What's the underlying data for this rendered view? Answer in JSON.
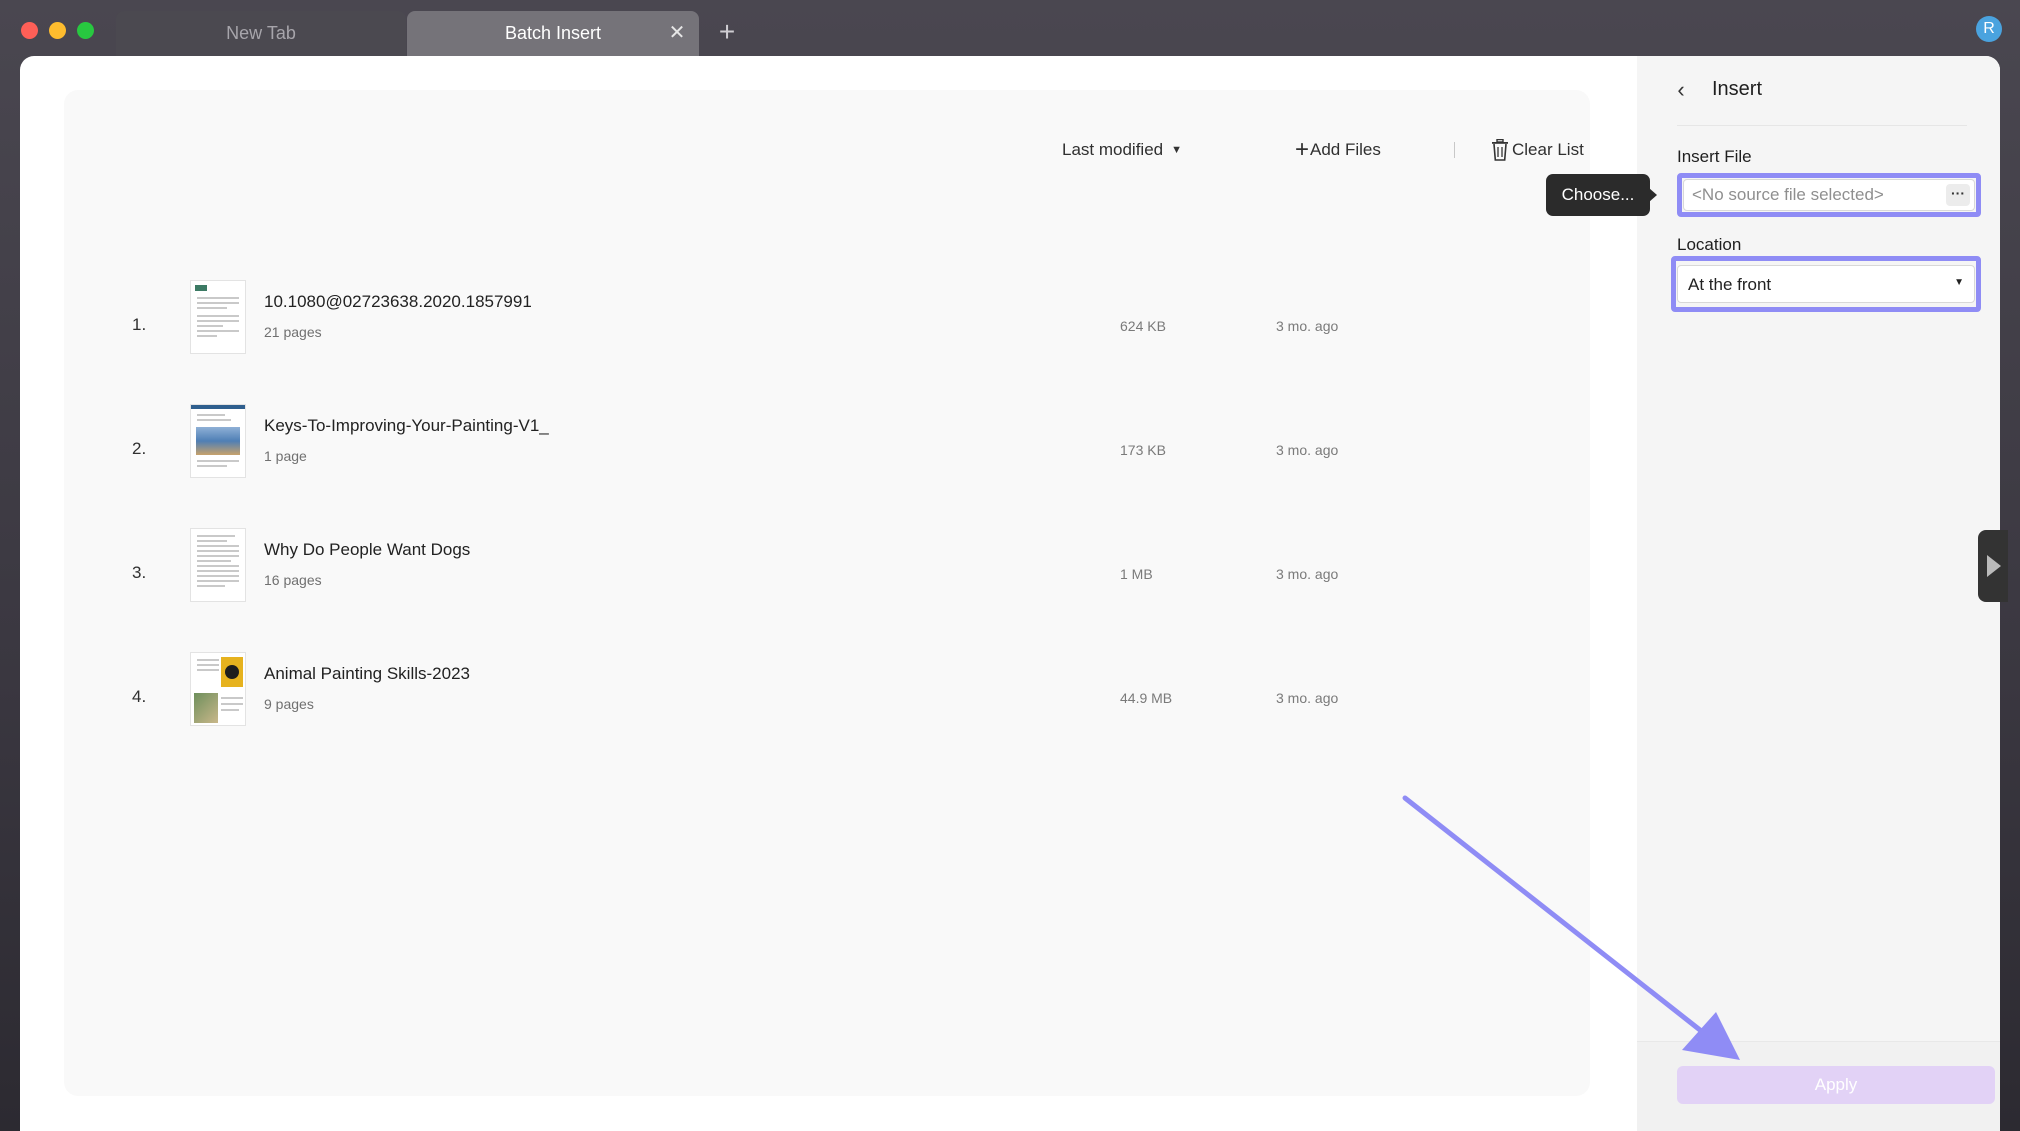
{
  "browser": {
    "tabs": [
      {
        "label": "New Tab"
      },
      {
        "label": "Batch Insert"
      }
    ],
    "new_tab_symbol": "+",
    "close_symbol": "✕",
    "user_initial": "R"
  },
  "toolbar": {
    "sort_label": "Last modified",
    "add_files_label": "Add Files",
    "clear_list_label": "Clear List"
  },
  "files": [
    {
      "index": "1.",
      "name": "10.1080@02723638.2020.1857991",
      "pages": "21 pages",
      "size": "624 KB",
      "modified": "3 mo. ago"
    },
    {
      "index": "2.",
      "name": "Keys-To-Improving-Your-Painting-V1_",
      "pages": "1 page",
      "size": "173 KB",
      "modified": "3 mo. ago"
    },
    {
      "index": "3.",
      "name": "Why Do People Want Dogs",
      "pages": "16 pages",
      "size": "1 MB",
      "modified": "3 mo. ago"
    },
    {
      "index": "4.",
      "name": "Animal Painting Skills-2023",
      "pages": "9 pages",
      "size": "44.9 MB",
      "modified": "3 mo. ago"
    }
  ],
  "panel": {
    "title": "Insert",
    "insert_file_label": "Insert File",
    "insert_file_placeholder": "<No source file selected>",
    "browse_label": "···",
    "tooltip": "Choose...",
    "location_label": "Location",
    "location_value": "At the front",
    "apply_label": "Apply"
  },
  "colors": {
    "highlight": "#8f8cf5",
    "apply_disabled": "#e2d2f6",
    "annotation_arrow": "#8f8cf5"
  },
  "icons": [
    "chevron-left-icon",
    "trash-icon",
    "plus-icon",
    "caret-down-icon",
    "more-icon",
    "play-right-icon"
  ]
}
